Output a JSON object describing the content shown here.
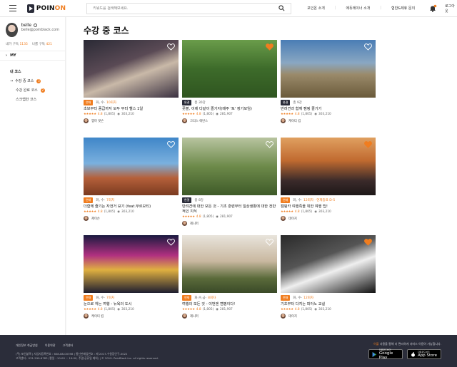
{
  "header": {
    "logo_text": "POIN",
    "logo_accent": "ON",
    "search_placeholder": "키워드를 검색해보세요.",
    "nav": [
      "포인온 소개",
      "에듀테이너 소개",
      "협찬&제휴 문의"
    ],
    "logout": "로그아웃",
    "accent_color": "#f07d1f"
  },
  "sidebar": {
    "profile_name": "belle",
    "profile_email": "belle@poinblack.com",
    "followers_label": "내가 구독",
    "followers_count": "1135",
    "following_label": "나를 구독",
    "following_count": "421",
    "my_label": "MY",
    "my_course_heading": "내 코스",
    "items": [
      {
        "label": "수강 중 코스",
        "badge": "3"
      },
      {
        "label": "수강 완료 코스",
        "badge": "2"
      },
      {
        "label": "스크랩한 코스",
        "badge": ""
      }
    ]
  },
  "main": {
    "title": "수강 중 코스",
    "cards": [
      {
        "tag": "연재",
        "tag_color": "orange",
        "days": "화, 수",
        "sep": " · ",
        "episodes": "10회차",
        "title": "초보부터 중급까지 모두 부터 헬스 1일",
        "stars": "★★★★★",
        "rating": "4.8",
        "reviews": "(1,805)",
        "views": "303,210",
        "instructor": "엠마 왓슨",
        "liked": false
      },
      {
        "tag": "완결",
        "tag_color": "dark",
        "days": "총 30강",
        "sep": "",
        "episodes": "",
        "title": "풋볼, 이제 다같이 즐기자(매주 '토' 정기모임)",
        "stars": "★★★★★",
        "rating": "4.8",
        "reviews": "(1,805)",
        "views": "281,907",
        "instructor": "크리스 에반스",
        "liked": true
      },
      {
        "tag": "완결",
        "tag_color": "dark",
        "days": "총 9강",
        "sep": "",
        "episodes": "",
        "title": "반려견과 함께 캠핑 즐기기",
        "stars": "★★★★★",
        "rating": "4.8",
        "reviews": "(1,805)",
        "views": "303,210",
        "instructor": "케이티 킴",
        "liked": false
      },
      {
        "tag": "연재",
        "tag_color": "orange",
        "days": "화, 수",
        "sep": " · ",
        "episodes": "7회차",
        "title": "더함께 즐기는 자전거 묘기 (feat.부르모티)",
        "stars": "★★★★★",
        "rating": "4.8",
        "reviews": "(1,805)",
        "views": "303,210",
        "instructor": "제이슨",
        "liked": false
      },
      {
        "tag": "완결",
        "tag_color": "dark",
        "days": "총 8강",
        "sep": "",
        "episodes": "",
        "title": "반려견에 대한 모든 것 - 기초 훈련부터 일상생활에 대한 전반적인 지식",
        "stars": "★★★★★",
        "rating": "4.8",
        "reviews": "(1,805)",
        "views": "281,907",
        "instructor": "제니퍼",
        "liked": false
      },
      {
        "tag": "연재",
        "tag_color": "orange",
        "days": "화, 수",
        "sep": " · ",
        "episodes": "12회차 · 연재종료 D-5",
        "title": "캠핑카 여행족을 위한 여행 팁!",
        "stars": "★★★★★",
        "rating": "4.8",
        "reviews": "(1,805)",
        "views": "303,210",
        "instructor": "데이지",
        "liked": true
      },
      {
        "tag": "연재",
        "tag_color": "orange",
        "days": "화, 수",
        "sep": " · ",
        "episodes": "7회차",
        "title": "눈으로 하는 여행 - 뉴욕의 도시",
        "stars": "★★★★★",
        "rating": "4.8",
        "reviews": "(1,805)",
        "views": "303,210",
        "instructor": "케이티 킴",
        "liked": false
      },
      {
        "tag": "연재",
        "tag_color": "orange",
        "days": "화,수,금",
        "sep": " · ",
        "episodes": "8회차",
        "title": "여행의 모든 것 - 이번엔 캠핑이다!",
        "stars": "★★★★★",
        "rating": "4.8",
        "reviews": "(1,805)",
        "views": "281,907",
        "instructor": "제니퍼",
        "liked": false
      },
      {
        "tag": "연재",
        "tag_color": "orange",
        "days": "화, 수",
        "sep": " · ",
        "episodes": "12회차",
        "title": "기초부터 다지는 피아노 교실",
        "stars": "★★★★★",
        "rating": "4.8",
        "reviews": "(1,805)",
        "views": "303,210",
        "instructor": "데이지",
        "liked": true
      }
    ]
  },
  "footer": {
    "links": [
      "개인정보 취급방침",
      "이용약관",
      "고객센터"
    ],
    "info_line1": "(주) 포인블랙 | 사업자등록번호 : 608-88-00398 | 통신판매업번호 : 제 2017-수원장안구-0022",
    "info_line2": "고객센터 : 031-299-6783 (평일 : 10:00 ~ 19:00, 주말/공휴일 제외) | © 2019. PoinBlack inc. all rights reserved.",
    "app_prefix": "어플",
    "app_text": " 사용을 통해 더 편리하게 서비스 이용이 가능합니다.",
    "google_small": "다운로드하기",
    "google_big": "Google Play",
    "apple_small": "다운로드하기",
    "apple_big": "App Store",
    "bg_color": "#2b2d3a"
  }
}
